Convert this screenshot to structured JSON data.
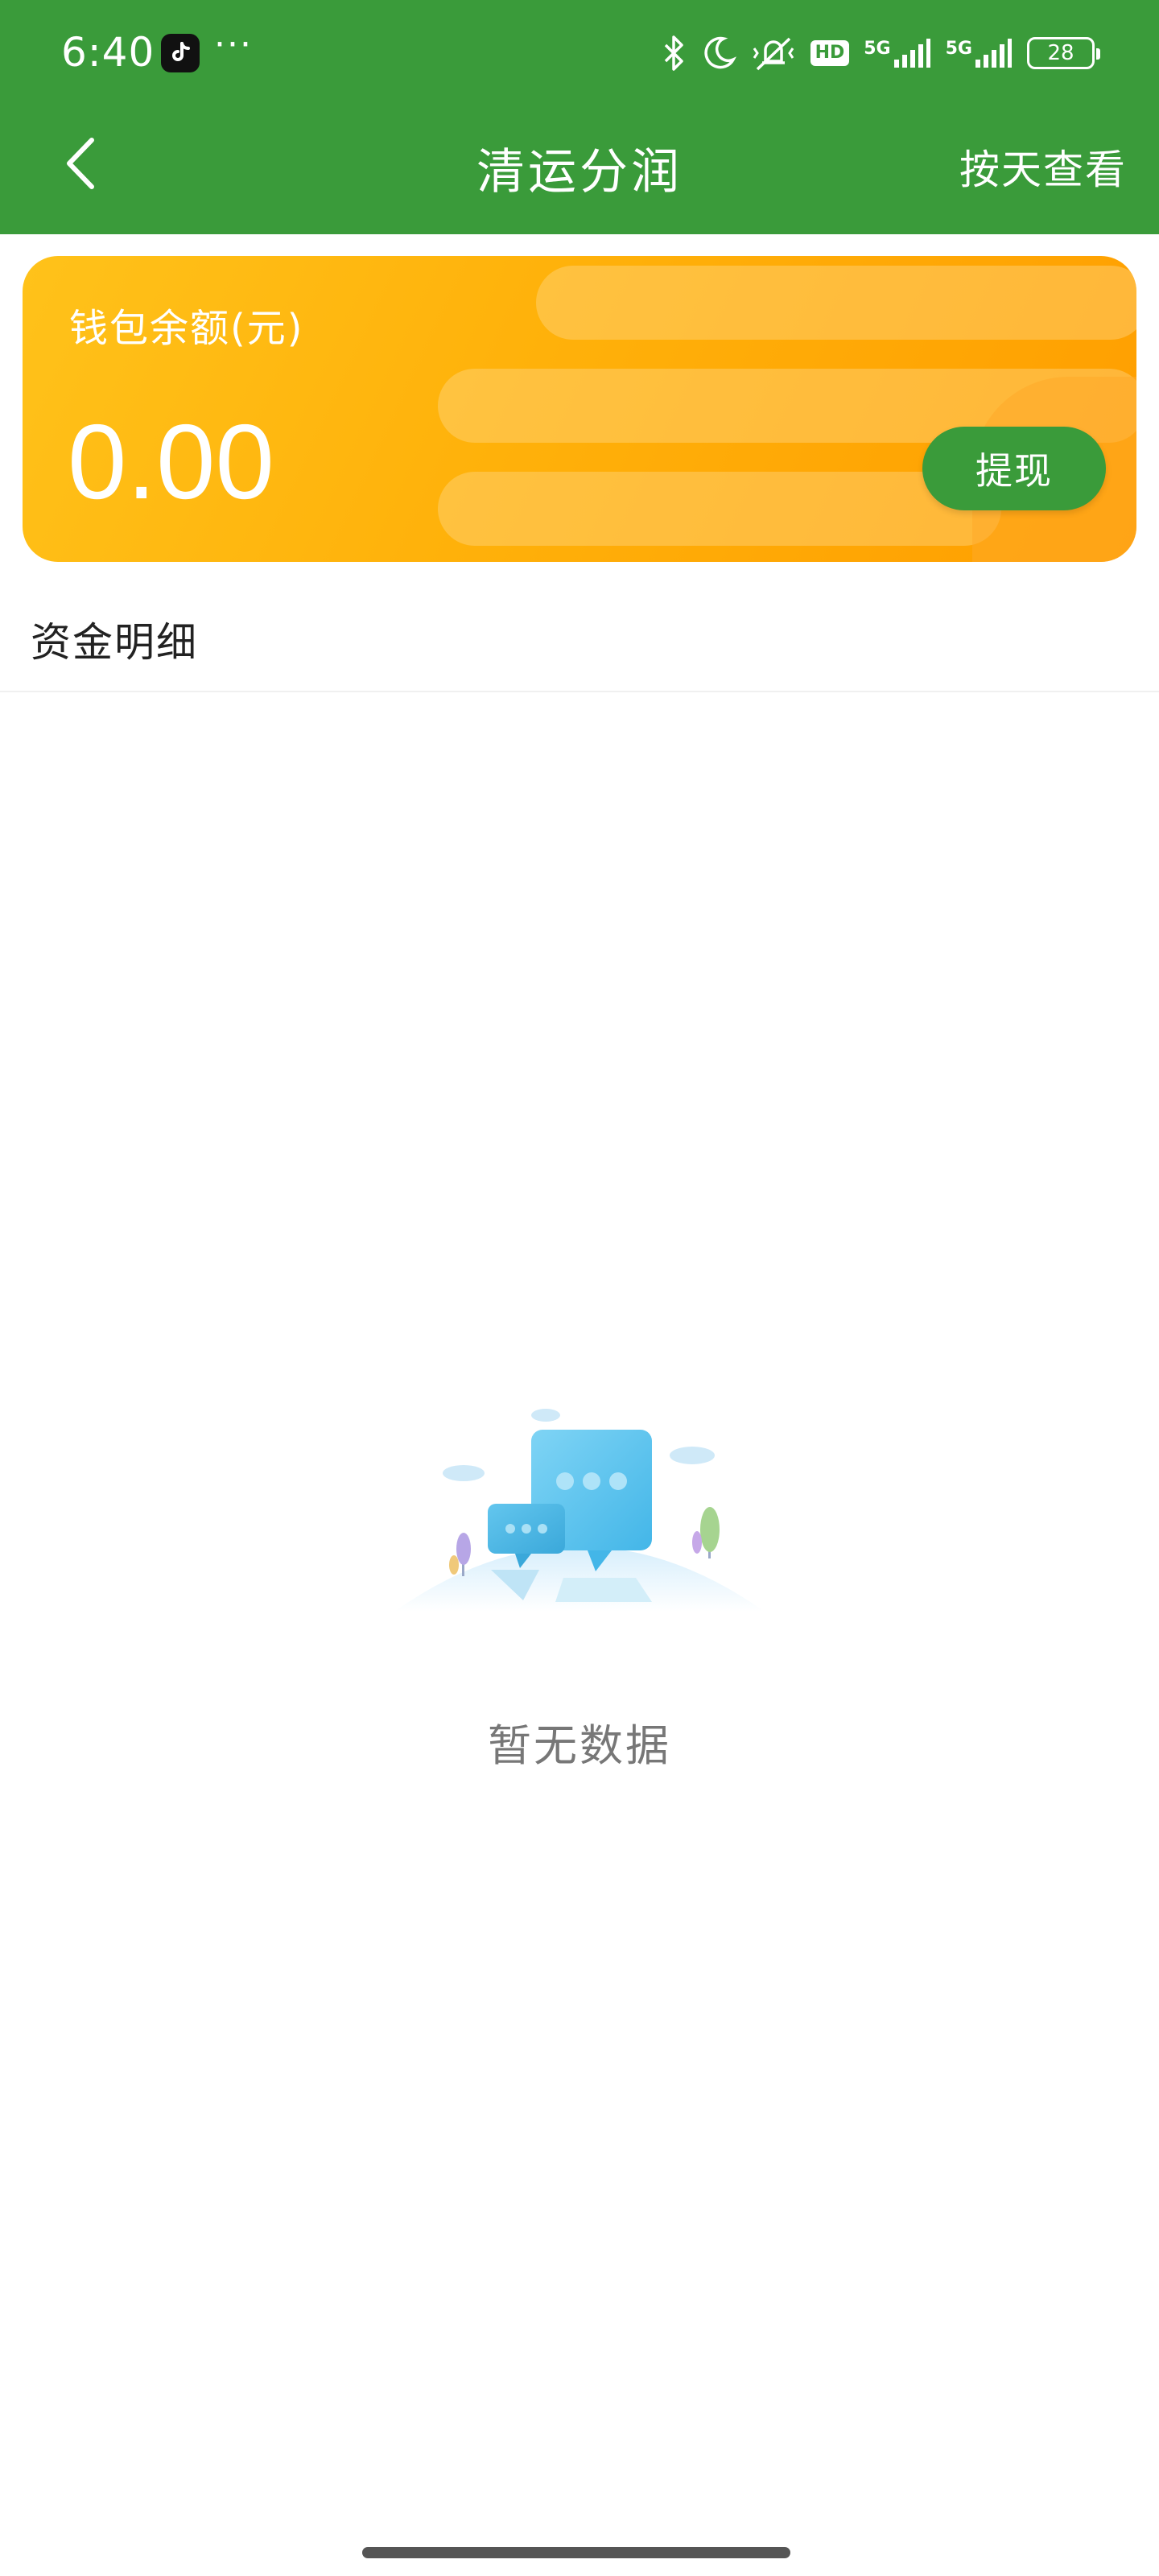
{
  "status_bar": {
    "time": "6:40",
    "more": "···",
    "hd_badge": "HD",
    "net1": "5G",
    "net2": "5G",
    "battery": "28"
  },
  "nav": {
    "title": "清运分润",
    "action_label": "按天查看"
  },
  "wallet": {
    "label": "钱包余额(元)",
    "amount": "0.00",
    "withdraw_label": "提现"
  },
  "details": {
    "section_title": "资金明细",
    "empty_text": "暂无数据"
  },
  "colors": {
    "primary_green": "#3a9b3a",
    "card_orange": "#ffb10a"
  }
}
